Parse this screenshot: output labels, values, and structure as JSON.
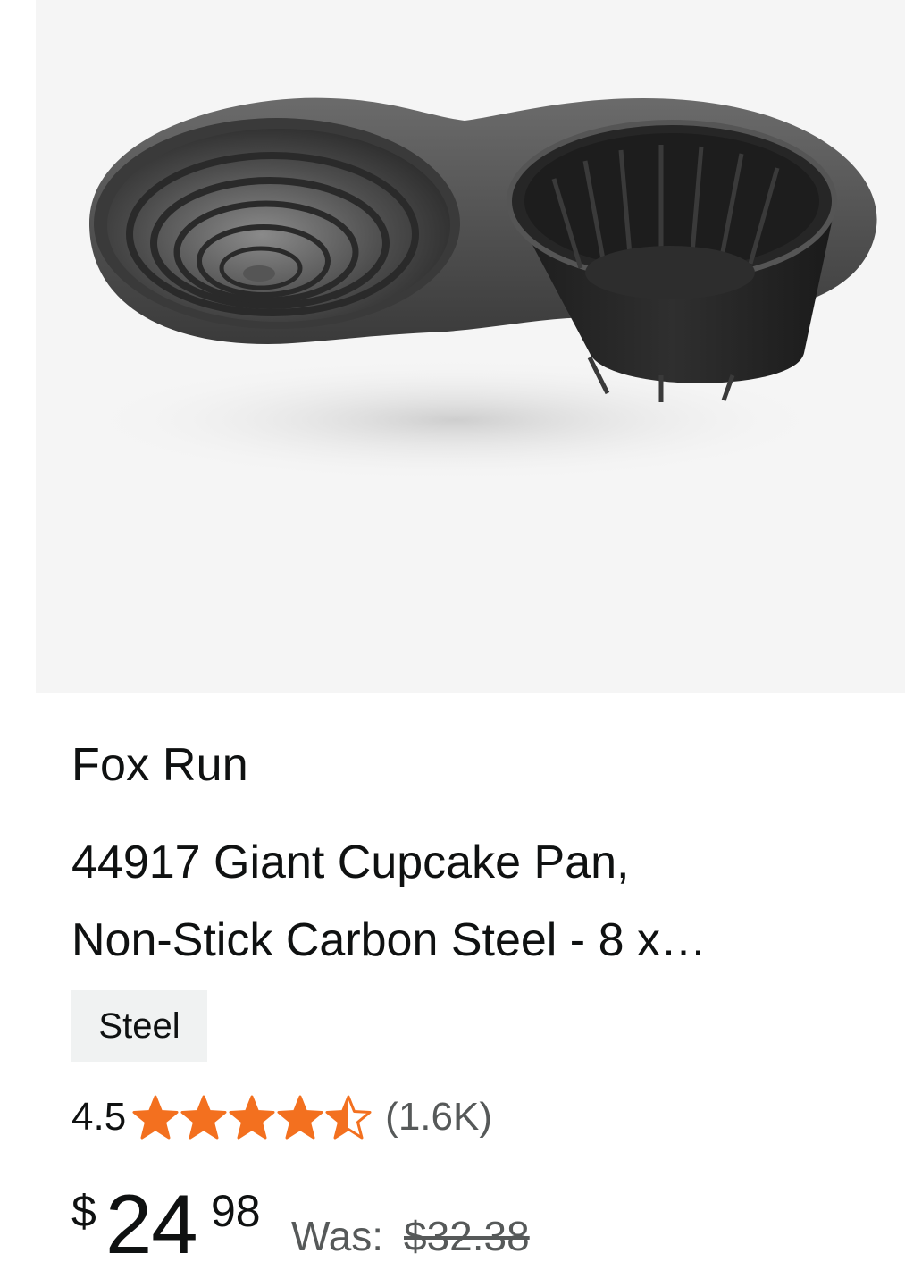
{
  "product": {
    "image_alt": "Giant cupcake pan product photo",
    "brand": "Fox Run",
    "title_line1": "44917 Giant Cupcake Pan,",
    "title_line2": "Non-Stick Carbon Steel - 8 x…",
    "material_tag": "Steel",
    "rating": {
      "value": "4.5",
      "stars": 4.5,
      "max_stars": 5,
      "review_count": "(1.6K)",
      "star_color": "#f3701f"
    },
    "price": {
      "currency": "$",
      "whole": "24",
      "fraction": "98",
      "was_label": "Was:",
      "was_price": "$32.38"
    }
  }
}
